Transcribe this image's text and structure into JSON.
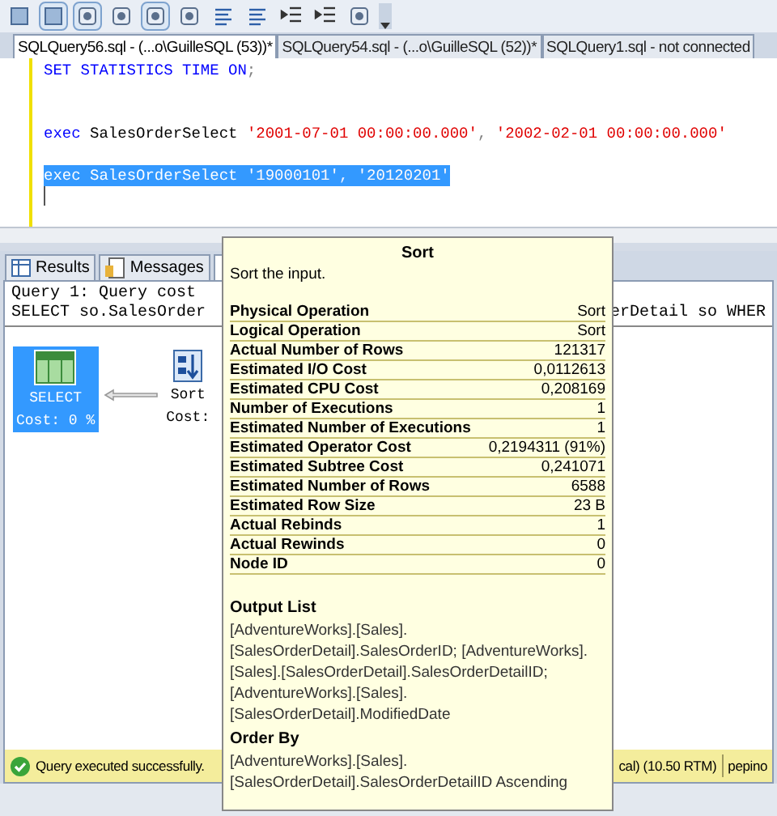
{
  "editor_tabs": [
    {
      "label": "SQLQuery56.sql - (...o\\GuilleSQL (53))*",
      "selected": true
    },
    {
      "label": "SQLQuery54.sql - (...o\\GuilleSQL (52))*",
      "selected": false
    },
    {
      "label": "SQLQuery1.sql - not connected",
      "selected": false
    }
  ],
  "editor_lines": [
    {
      "selected": false,
      "tokens": [
        {
          "kind": "keyword",
          "text": "SET STATISTICS TIME ON"
        },
        {
          "kind": "punct",
          "text": ";"
        }
      ]
    },
    {
      "selected": false,
      "tokens": [
        {
          "kind": "keyword",
          "text": "exec"
        },
        {
          "kind": "ident",
          "text": " SalesOrderSelect "
        },
        {
          "kind": "string",
          "text": "'2001-07-01 00:00:00.000'"
        },
        {
          "kind": "punct",
          "text": ", "
        },
        {
          "kind": "string",
          "text": "'2002-02-01 00:00:00.000'"
        }
      ]
    },
    {
      "selected": true,
      "tokens": [
        {
          "kind": "keyword",
          "text": "exec"
        },
        {
          "kind": "ident",
          "text": " SalesOrderSelect "
        },
        {
          "kind": "string",
          "text": "'19000101'"
        },
        {
          "kind": "punct",
          "text": ", "
        },
        {
          "kind": "string",
          "text": "'20120201'"
        }
      ]
    }
  ],
  "result_tabs": [
    {
      "label": "Results",
      "kind": "grid",
      "selected": false
    },
    {
      "label": "Messages",
      "kind": "messages",
      "selected": false
    },
    {
      "kind": "plan",
      "selected": true
    }
  ],
  "query_header": {
    "line_1": "Query 1: Query cost",
    "line_2_start": "SELECT so.SalesOrder",
    "line_2_end": "erDetail so WHER"
  },
  "plan_nodes": [
    {
      "kind": "select",
      "label": "SELECT",
      "cost": "Cost: 0 %",
      "selected": true
    },
    {
      "kind": "sort",
      "label": "Sort",
      "cost": "Cost:",
      "selected": false
    }
  ],
  "tooltip": {
    "title": "Sort",
    "description": "Sort the input.",
    "properties": [
      {
        "name": "Physical Operation",
        "value": "Sort"
      },
      {
        "name": "Logical Operation",
        "value": "Sort"
      },
      {
        "name": "Actual Number of Rows",
        "value": "121317"
      },
      {
        "name": "Estimated I/O Cost",
        "value": "0,0112613"
      },
      {
        "name": "Estimated CPU Cost",
        "value": "0,208169"
      },
      {
        "name": "Number of Executions",
        "value": "1"
      },
      {
        "name": "Estimated Number of Executions",
        "value": "1"
      },
      {
        "name": "Estimated Operator Cost",
        "value": "0,2194311 (91%)"
      },
      {
        "name": "Estimated Subtree Cost",
        "value": "0,241071"
      },
      {
        "name": "Estimated Number of Rows",
        "value": "6588"
      },
      {
        "name": "Estimated Row Size",
        "value": "23 B"
      },
      {
        "name": "Actual Rebinds",
        "value": "1"
      },
      {
        "name": "Actual Rewinds",
        "value": "0"
      },
      {
        "name": "Node ID",
        "value": "0"
      }
    ],
    "sections": [
      {
        "heading": "Output List",
        "text": "[AdventureWorks].[Sales].[SalesOrderDetail].SalesOrderID; [AdventureWorks].[Sales].[SalesOrderDetail].SalesOrderDetailID; [AdventureWorks].[Sales].[SalesOrderDetail].ModifiedDate"
      },
      {
        "heading": "Order By",
        "text": "[AdventureWorks].[Sales].[SalesOrderDetail].SalesOrderDetailID Ascending"
      }
    ]
  },
  "status_bar": {
    "message": "Query executed successfully.",
    "server": "cal) (10.50 RTM)",
    "user": "pepino"
  }
}
